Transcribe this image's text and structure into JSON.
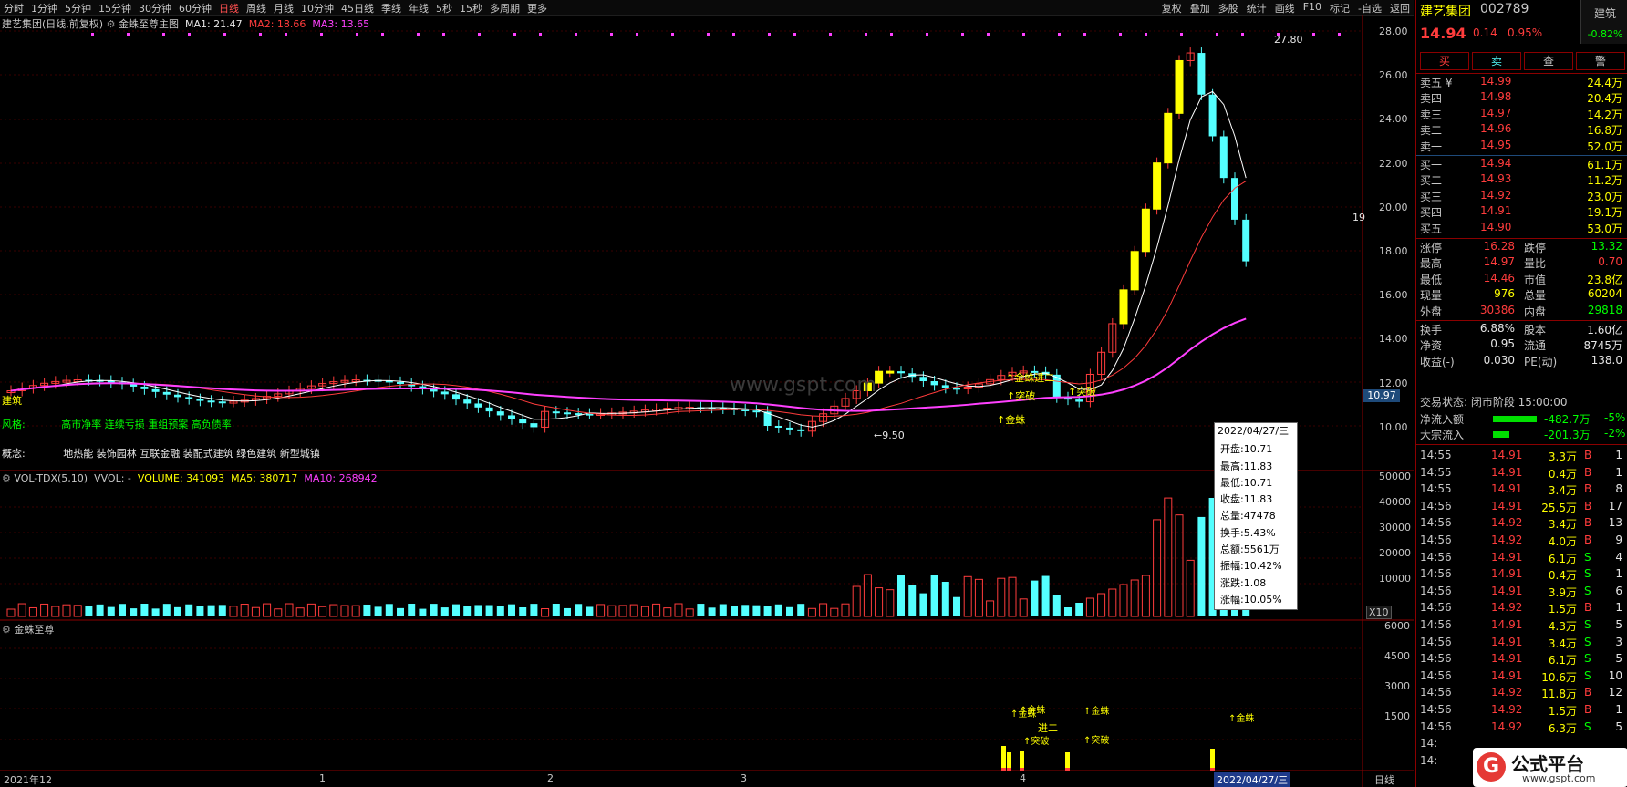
{
  "toolbar": {
    "periods": [
      "分时",
      "1分钟",
      "5分钟",
      "15分钟",
      "30分钟",
      "60分钟",
      "日线",
      "周线",
      "月线",
      "10分钟",
      "45日线",
      "季线",
      "年线",
      "5秒",
      "15秒",
      "多周期",
      "更多"
    ],
    "active_period": "日线",
    "right_items": [
      "复权",
      "叠加",
      "多股",
      "统计",
      "画线",
      "F10",
      "标记",
      "-自选",
      "返回"
    ]
  },
  "main_pane": {
    "title": "建艺集团(日线,前复权)",
    "indicator": "金蛛至尊主图",
    "ma1": "MA1: 21.47",
    "ma2": "MA2: 18.66",
    "ma3": "MA3: 13.65",
    "style_label": "风格:",
    "style_tags": "高市净率  连续亏损  重组预案  高负债率",
    "concept_label": "概念:",
    "concept_tags": "地热能  装饰园林  互联金融  装配式建筑  绿色建筑  新型城镇",
    "left_tag": "建筑",
    "watermark": "www.gspt.com",
    "price_axis": [
      "28.00",
      "26.00",
      "24.00",
      "22.00",
      "20.00",
      "18.00",
      "16.00",
      "14.00",
      "12.00",
      "10.00"
    ],
    "current_price_tag": "10.97",
    "max_label": "27.80",
    "min_label": "←9.50",
    "right_clip": "19",
    "annotations": {
      "jinzhu1": "↑金蛛",
      "jinzhu2": "↑金蛛进二",
      "tupo1": "↑突破",
      "tupo2": "↑突破"
    }
  },
  "vol_pane": {
    "title": "VOL-TDX(5,10)",
    "vvol": "VVOL: -",
    "volume": "VOLUME: 341093",
    "ma5": "MA5: 380717",
    "ma10": "MA10: 268942",
    "axis": [
      "50000",
      "40000",
      "30000",
      "20000",
      "10000"
    ],
    "unit": "X10"
  },
  "sub_pane": {
    "title": "金蛛至尊",
    "axis": [
      "6000",
      "4500",
      "3000",
      "1500"
    ],
    "annotations": {
      "a1": "↑金蛛",
      "a2": "↑金蛛",
      "a3": "↑突破",
      "a4": "进二",
      "a5": "↑金蛛",
      "a6": "↑突破",
      "a7": "↑金蛛"
    }
  },
  "time_axis": {
    "labels": [
      "2021年12",
      "1",
      "2",
      "3",
      "4"
    ],
    "cursor_date": "2022/04/27/三",
    "period": "日线"
  },
  "tooltip": {
    "date": "2022/04/27/三",
    "lines": [
      "开盘:10.71",
      "最高:11.83",
      "最低:10.71",
      "收盘:11.83",
      "总量:47478",
      "换手:5.43%",
      "总额:5561万",
      "振幅:10.42%",
      "涨跌:1.08",
      "涨幅:10.05%"
    ]
  },
  "quote": {
    "name": "建艺集团",
    "code": "002789",
    "sector": "建筑",
    "sector_change": "-0.82%",
    "price": "14.94",
    "change": "0.14",
    "pct": "0.95%",
    "buttons": [
      "买",
      "卖",
      "查",
      "警"
    ],
    "asks": [
      {
        "label": "卖五 ¥",
        "price": "14.99",
        "vol": "24.4万"
      },
      {
        "label": "卖四",
        "price": "14.98",
        "vol": "20.4万"
      },
      {
        "label": "卖三",
        "price": "14.97",
        "vol": "14.2万"
      },
      {
        "label": "卖二",
        "price": "14.96",
        "vol": "16.8万"
      },
      {
        "label": "卖一",
        "price": "14.95",
        "vol": "52.0万"
      }
    ],
    "bids": [
      {
        "label": "买一",
        "price": "14.94",
        "vol": "61.1万"
      },
      {
        "label": "买二",
        "price": "14.93",
        "vol": "11.2万"
      },
      {
        "label": "买三",
        "price": "14.92",
        "vol": "23.0万"
      },
      {
        "label": "买四",
        "price": "14.91",
        "vol": "19.1万"
      },
      {
        "label": "买五",
        "price": "14.90",
        "vol": "53.0万"
      }
    ],
    "stats": [
      {
        "l1": "涨停",
        "v1": "16.28",
        "l2": "跌停",
        "v2": "13.32"
      },
      {
        "l1": "最高",
        "v1": "14.97",
        "l2": "量比",
        "v2": "0.70"
      },
      {
        "l1": "最低",
        "v1": "14.46",
        "l2": "市值",
        "v2": "23.8亿"
      },
      {
        "l1": "现量",
        "v1": "976",
        "l2": "总量",
        "v2": "60204"
      },
      {
        "l1": "外盘",
        "v1": "30386",
        "l2": "内盘",
        "v2": "29818"
      },
      {
        "l1": "换手",
        "v1": "6.88%",
        "l2": "股本",
        "v2": "1.60亿"
      },
      {
        "l1": "净资",
        "v1": "0.95",
        "l2": "流通",
        "v2": "8745万"
      },
      {
        "l1": "收益(-)",
        "v1": "0.030",
        "l2": "PE(动)",
        "v2": "138.0"
      }
    ],
    "trade_status": "交易状态: 闭市阶段 15:00:00",
    "net_inflow_label": "净流入额",
    "net_inflow": "-482.7万",
    "net_inflow_pct": "-5%",
    "big_inflow_label": "大宗流入",
    "big_inflow": "-201.3万",
    "big_inflow_pct": "-2%",
    "ticks": [
      {
        "t": "14:55",
        "p": "14.91",
        "v": "3.3万",
        "bs": "B",
        "n": "1"
      },
      {
        "t": "14:55",
        "p": "14.91",
        "v": "0.4万",
        "bs": "B",
        "n": "1"
      },
      {
        "t": "14:55",
        "p": "14.91",
        "v": "3.4万",
        "bs": "B",
        "n": "8"
      },
      {
        "t": "14:56",
        "p": "14.91",
        "v": "25.5万",
        "bs": "B",
        "n": "17"
      },
      {
        "t": "14:56",
        "p": "14.92",
        "v": "3.4万",
        "bs": "B",
        "n": "13"
      },
      {
        "t": "14:56",
        "p": "14.92",
        "v": "4.0万",
        "bs": "B",
        "n": "9"
      },
      {
        "t": "14:56",
        "p": "14.91",
        "v": "6.1万",
        "bs": "S",
        "n": "4"
      },
      {
        "t": "14:56",
        "p": "14.91",
        "v": "0.4万",
        "bs": "S",
        "n": "1"
      },
      {
        "t": "14:56",
        "p": "14.91",
        "v": "3.9万",
        "bs": "S",
        "n": "6"
      },
      {
        "t": "14:56",
        "p": "14.92",
        "v": "1.5万",
        "bs": "B",
        "n": "1"
      },
      {
        "t": "14:56",
        "p": "14.91",
        "v": "4.3万",
        "bs": "S",
        "n": "5"
      },
      {
        "t": "14:56",
        "p": "14.91",
        "v": "3.4万",
        "bs": "S",
        "n": "3"
      },
      {
        "t": "14:56",
        "p": "14.91",
        "v": "6.1万",
        "bs": "S",
        "n": "5"
      },
      {
        "t": "14:56",
        "p": "14.91",
        "v": "10.6万",
        "bs": "S",
        "n": "10"
      },
      {
        "t": "14:56",
        "p": "14.92",
        "v": "11.8万",
        "bs": "B",
        "n": "12"
      },
      {
        "t": "14:56",
        "p": "14.92",
        "v": "1.5万",
        "bs": "B",
        "n": "1"
      },
      {
        "t": "14:56",
        "p": "14.92",
        "v": "6.3万",
        "bs": "S",
        "n": "5"
      },
      {
        "t": "14:",
        "p": "",
        "v": "",
        "bs": "",
        "n": ""
      },
      {
        "t": "14:",
        "p": "",
        "v": "",
        "bs": "",
        "n": ""
      }
    ],
    "logo_text": "公式平台",
    "logo_url": "www.gspt.com"
  },
  "colors": {
    "up": "#ff3c3c",
    "down": "#54ffff",
    "ma1": "#ffffff",
    "ma2": "#ff3c3c",
    "ma3": "#ff40ff",
    "signal": "#ffff00",
    "frame": "#8b0000"
  }
}
